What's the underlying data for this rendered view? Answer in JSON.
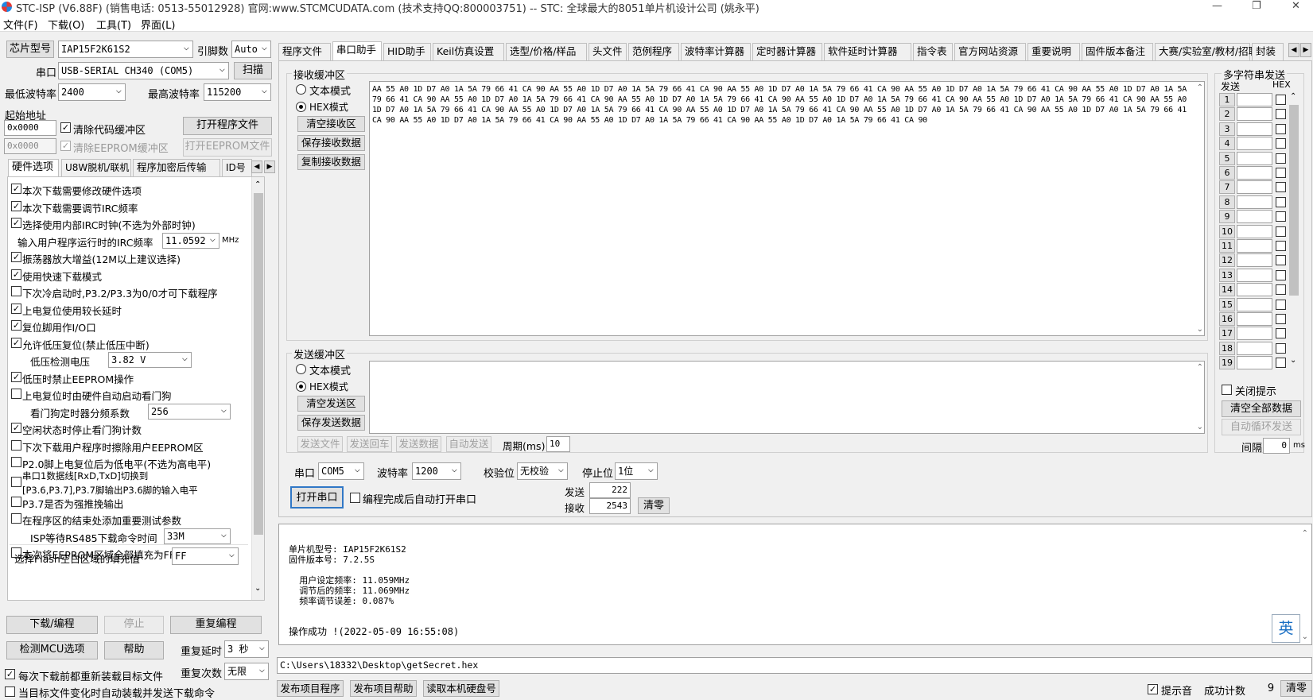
{
  "window": {
    "title": "STC-ISP (V6.88F) (销售电话: 0513-55012928) 官网:www.STCMCUDATA.com  (技术支持QQ:800003751) -- STC: 全球最大的8051单片机设计公司 (姚永平)",
    "min": "—",
    "max": "❐",
    "close": "✕"
  },
  "menu": [
    "文件(F)",
    "下载(O)",
    "工具(T)",
    "界面(L)"
  ],
  "left": {
    "chip_label": "芯片型号",
    "chip_value": "IAP15F2K61S2",
    "pins_label": "引脚数",
    "pins_value": "Auto",
    "port_label": "串口",
    "port_value": "USB-SERIAL CH340 (COM5)",
    "scan_button": "扫描",
    "min_baud_label": "最低波特率",
    "min_baud_value": "2400",
    "max_baud_label": "最高波特率",
    "max_baud_value": "115200",
    "start_addr_label": "起始地址",
    "code_addr": "0x0000",
    "clear_code": "清除代码缓冲区",
    "open_prog": "打开程序文件",
    "eeprom_addr": "0x0000",
    "clear_eeprom": "清除EEPROM缓冲区",
    "open_eeprom": "打开EEPROM文件",
    "tabs": [
      "硬件选项",
      "U8W脱机/联机",
      "程序加密后传输",
      "ID号"
    ],
    "hw": [
      {
        "c": true,
        "t": "本次下载需要修改硬件选项"
      },
      {
        "c": true,
        "t": "本次下载需要调节IRC频率"
      },
      {
        "c": true,
        "t": "选择使用内部IRC时钟(不选为外部时钟)"
      },
      {
        "c": null,
        "t": "输入用户程序运行时的IRC频率"
      },
      {
        "c": true,
        "t": "振荡器放大增益(12M以上建议选择)"
      },
      {
        "c": true,
        "t": "使用快速下载模式"
      },
      {
        "c": false,
        "t": "下次冷启动时,P3.2/P3.3为0/0才可下载程序"
      },
      {
        "c": true,
        "t": "上电复位使用较长延时"
      },
      {
        "c": true,
        "t": "复位脚用作I/O口"
      },
      {
        "c": true,
        "t": "允许低压复位(禁止低压中断)"
      },
      {
        "c": null,
        "t": "低压检测电压"
      },
      {
        "c": true,
        "t": "低压时禁止EEPROM操作"
      },
      {
        "c": false,
        "t": "上电复位时由硬件自动启动看门狗"
      },
      {
        "c": null,
        "t": "看门狗定时器分频系数"
      },
      {
        "c": true,
        "t": "空闲状态时停止看门狗计数"
      },
      {
        "c": false,
        "t": "下次下载用户程序时擦除用户EEPROM区"
      },
      {
        "c": false,
        "t": "P2.0脚上电复位后为低电平(不选为高电平)"
      },
      {
        "c": false,
        "t": "串口1数据线[RxD,TxD]切换到"
      },
      {
        "c": false,
        "t": "P3.7是否为强推挽输出"
      },
      {
        "c": false,
        "t": "在程序区的结束处添加重要测试参数"
      },
      {
        "c": null,
        "t": "ISP等待RS485下载命令时间"
      },
      {
        "c": false,
        "t": "本次将EEPROM区域全部填充为FF"
      }
    ],
    "serial_switch_line2": "[P3.6,P3.7],P3.7脚输出P3.6脚的输入电平",
    "irc_value": "11.0592",
    "irc_unit": "MHz",
    "lvd_value": "3.82 V",
    "wdt_value": "256",
    "rs485_value": "33M",
    "flash_fill_label": "选择Flash空白区域的填充值",
    "flash_fill_value": "FF",
    "download_button": "下载/编程",
    "stop_button": "停止",
    "reprogram_button": "重复编程",
    "detect_button": "检测MCU选项",
    "help_button": "帮助",
    "repeat_delay_label": "重复延时",
    "repeat_delay_value": "3 秒",
    "repeat_count_label": "重复次数",
    "repeat_count_value": "无限",
    "reload_label": "每次下载前都重新装载目标文件",
    "autoload_label": "当目标文件变化时自动装载并发送下载命令"
  },
  "tabs": [
    "程序文件",
    "串口助手",
    "HID助手",
    "Keil仿真设置",
    "选型/价格/样品",
    "头文件",
    "范例程序",
    "波特率计算器",
    "定时器计算器",
    "软件延时计算器",
    "指令表",
    "官方网站资源",
    "重要说明",
    "固件版本备注",
    "大赛/实验室/教材/招聘",
    "封装"
  ],
  "recv": {
    "caption": "接收缓冲区",
    "text_mode": "文本模式",
    "hex_mode": "HEX模式",
    "clear": "清空接收区",
    "save": "保存接收数据",
    "copy": "复制接收数据",
    "content": "AA 55 A0 1D D7 A0 1A 5A 79 66 41 CA 90 AA 55 A0 1D D7 A0 1A 5A 79 66 41 CA 90 AA 55 A0 1D D7 A0 1A 5A 79 66 41 CA 90 AA 55 A0 1D D7 A0 1A 5A 79 66 41 CA 90 AA 55 A0 1D D7 A0 1A 5A 79 66 41 CA 90 AA 55 A0 1D D7 A0 1A 5A 79 66 41 CA 90 AA 55 A0 1D D7 A0 1A 5A 79 66 41 CA 90 AA 55 A0 1D D7 A0 1A 5A 79 66 41 CA 90 AA 55 A0 1D D7 A0 1A 5A 79 66 41 CA 90 AA 55 A0 1D D7 A0 1A 5A 79 66 41 CA 90 AA 55 A0 1D D7 A0 1A 5A 79 66 41 CA 90 AA 55 A0 1D D7 A0 1A 5A 79 66 41 CA 90 AA 55 A0 1D D7 A0 1A 5A 79 66 41 CA 90 AA 55 A0 1D D7 A0 1A 5A 79 66 41 CA 90 AA 55 A0 1D D7 A0 1A 5A 79 66 41 CA 90 AA 55 A0 1D D7 A0 1A 5A 79 66 41 CA 90 AA 55 A0 1D D7 A0 1A 5A 79 66 41 CA 90"
  },
  "send": {
    "caption": "发送缓冲区",
    "text_mode": "文本模式",
    "hex_mode": "HEX模式",
    "clear": "清空发送区",
    "save": "保存发送数据",
    "send_file": "发送文件",
    "send_enter": "发送回车",
    "send_data": "发送数据",
    "auto_send": "自动发送",
    "period_label": "周期(ms)",
    "period_value": "10"
  },
  "port": {
    "port_label": "串口",
    "port_value": "COM5",
    "baud_label": "波特率",
    "baud_value": "1200",
    "parity_label": "校验位",
    "parity_value": "无校验",
    "stop_label": "停止位",
    "stop_value": "1位",
    "open_button": "打开串口",
    "auto_open": "编程完成后自动打开串口",
    "sent_label": "发送",
    "sent_value": "222",
    "recv_label": "接收",
    "recv_value": "2543",
    "reset": "清零"
  },
  "multi": {
    "caption": "多字符串发送",
    "send_col": "发送",
    "hex_col": "HEX",
    "rows": [
      "1",
      "2",
      "3",
      "4",
      "5",
      "6",
      "7",
      "8",
      "9",
      "10",
      "11",
      "12",
      "13",
      "14",
      "15",
      "16",
      "17",
      "18",
      "19"
    ],
    "close_tips": "关闭提示",
    "clear_all": "清空全部数据",
    "auto_loop": "自动循环发送",
    "interval_label": "间隔",
    "interval_value": "0",
    "interval_unit": "ms"
  },
  "log": [
    "单片机型号: IAP15F2K61S2",
    "固件版本号: 7.2.5S",
    "",
    "  用户设定频率: 11.059MHz",
    "  调节后的频率: 11.069MHz",
    "  频率调节误差: 0.087%",
    "",
    "",
    "操作成功 !(2022-05-09 16:55:08)"
  ],
  "ime": "英",
  "path": "C:\\Users\\18332\\Desktop\\getSecret.hex",
  "bottom": {
    "publish": "发布项目程序",
    "publish_help": "发布项目帮助",
    "read_disk": "读取本机硬盘号",
    "sound": "提示音",
    "success_label": "成功计数",
    "success_value": "9",
    "clear": "清零"
  }
}
